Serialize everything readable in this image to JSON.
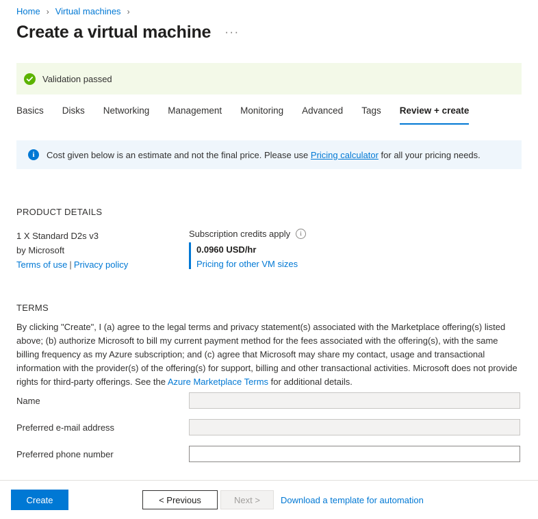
{
  "breadcrumb": {
    "items": [
      {
        "label": "Home"
      },
      {
        "label": "Virtual machines"
      }
    ],
    "separator": "›"
  },
  "header": {
    "title": "Create a virtual machine",
    "ellipsis": "···"
  },
  "validation": {
    "message": "Validation passed",
    "icon": "check-circle-icon",
    "background": "#f3f9e8",
    "icon_color": "#5cb300"
  },
  "tabs": [
    {
      "label": "Basics",
      "active": false
    },
    {
      "label": "Disks",
      "active": false
    },
    {
      "label": "Networking",
      "active": false
    },
    {
      "label": "Management",
      "active": false
    },
    {
      "label": "Monitoring",
      "active": false
    },
    {
      "label": "Advanced",
      "active": false
    },
    {
      "label": "Tags",
      "active": false
    },
    {
      "label": "Review + create",
      "active": true
    }
  ],
  "info_banner": {
    "icon": "info-circle-icon",
    "text_before": "Cost given below is an estimate and not the final price. Please use",
    "link_label": "Pricing calculator",
    "text_after": "for all your pricing needs.",
    "background": "#eff6fc",
    "accent": "#0078d4"
  },
  "product_details": {
    "heading": "PRODUCT DETAILS",
    "sku": "1 X Standard D2s v3",
    "publisher": "by Microsoft",
    "terms_of_use_label": "Terms of use",
    "separator": "|",
    "privacy_policy_label": "Privacy policy",
    "credits_label": "Subscription credits apply",
    "credits_info_icon": "info-outline-icon",
    "price": "0.0960 USD/hr",
    "pricing_link_label": "Pricing for other VM sizes",
    "accent": "#0078d4"
  },
  "terms": {
    "heading": "TERMS",
    "paragraph_part1": "By clicking \"Create\", I (a) agree to the legal terms and privacy statement(s) associated with the Marketplace offering(s) listed above; (b) authorize Microsoft to bill my current payment method for the fees associated with the offering(s), with the same billing frequency as my Azure subscription; and (c) agree that Microsoft may share my contact, usage and transactional information with the provider(s) of the offering(s) for support, billing and other transactional activities. Microsoft does not provide rights for third-party offerings. See the",
    "marketplace_link_label": "Azure Marketplace Terms",
    "paragraph_part2": "for additional details."
  },
  "form": {
    "fields": [
      {
        "label": "Name",
        "value": "",
        "placeholder": "",
        "disabled": true
      },
      {
        "label": "Preferred e-mail address",
        "value": "",
        "placeholder": "",
        "disabled": true
      },
      {
        "label": "Preferred phone number",
        "value": "",
        "placeholder": "",
        "disabled": false
      }
    ]
  },
  "footer": {
    "create_label": "Create",
    "previous_label": "< Previous",
    "next_label": "Next >",
    "download_link_label": "Download a template for automation",
    "primary_color": "#0078d4"
  }
}
